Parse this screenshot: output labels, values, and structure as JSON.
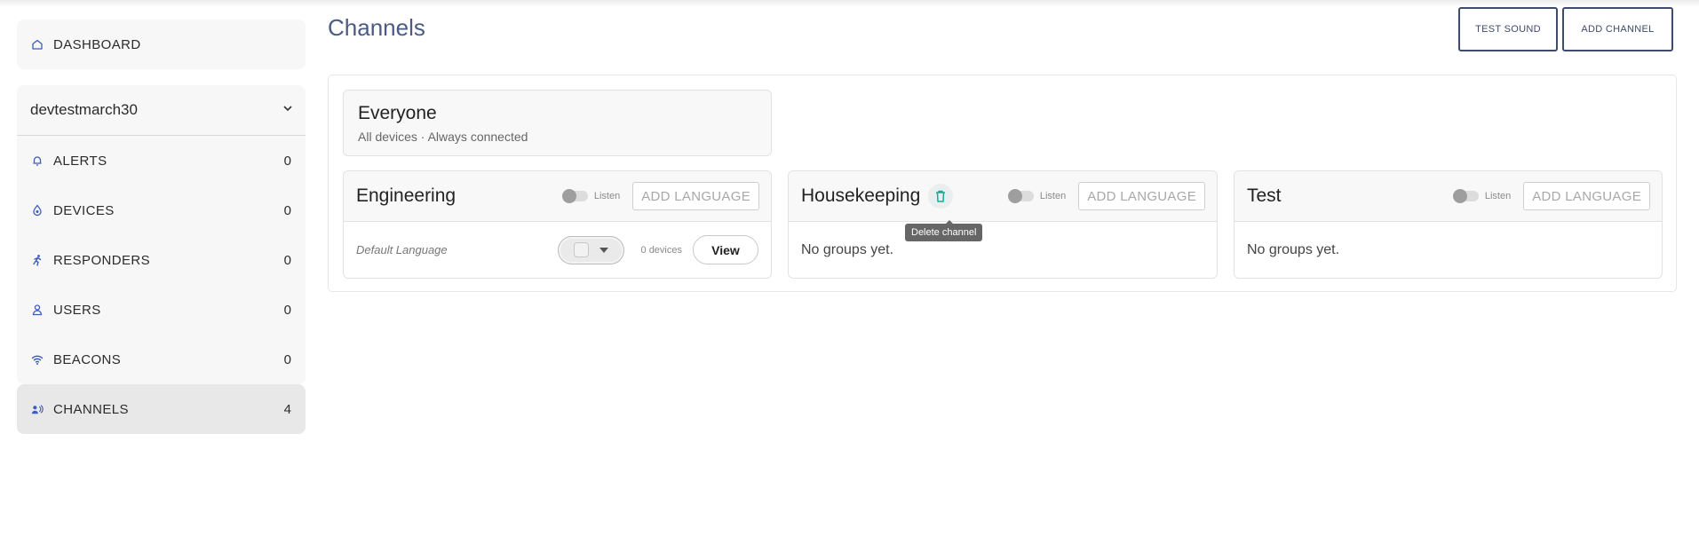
{
  "sidebar": {
    "dashboard": {
      "label": "DASHBOARD",
      "icon": "home-icon"
    },
    "org": {
      "name": "devtestmarch30",
      "icon": "chevron-down-icon"
    },
    "items": [
      {
        "label": "ALERTS",
        "count": "0",
        "icon": "bell-icon"
      },
      {
        "label": "DEVICES",
        "count": "0",
        "icon": "device-icon"
      },
      {
        "label": "RESPONDERS",
        "count": "0",
        "icon": "runner-icon"
      },
      {
        "label": "USERS",
        "count": "0",
        "icon": "user-icon"
      },
      {
        "label": "BEACONS",
        "count": "0",
        "icon": "wifi-icon"
      },
      {
        "label": "CHANNELS",
        "count": "4",
        "icon": "broadcast-user-icon"
      }
    ]
  },
  "header": {
    "title": "Channels",
    "test_sound": "TEST SOUND",
    "add_channel": "ADD CHANNEL"
  },
  "everyone": {
    "title": "Everyone",
    "subtitle": "All devices · Always connected"
  },
  "channels": [
    {
      "title": "Engineering",
      "listen_label": "Listen",
      "add_language": "ADD LANGUAGE",
      "default_language_label": "Default Language",
      "device_count": "0 devices",
      "view_label": "View"
    },
    {
      "title": "Housekeeping",
      "listen_label": "Listen",
      "add_language": "ADD LANGUAGE",
      "empty_text": "No groups yet.",
      "delete_tooltip": "Delete channel"
    },
    {
      "title": "Test",
      "listen_label": "Listen",
      "add_language": "ADD LANGUAGE",
      "empty_text": "No groups yet."
    }
  ],
  "colors": {
    "title": "#4a5b85",
    "button_border": "#3e4b6e",
    "icon_accent": "#3b5cb8",
    "trash_accent": "#1aa899",
    "active_nav": "#e8e8e8"
  }
}
